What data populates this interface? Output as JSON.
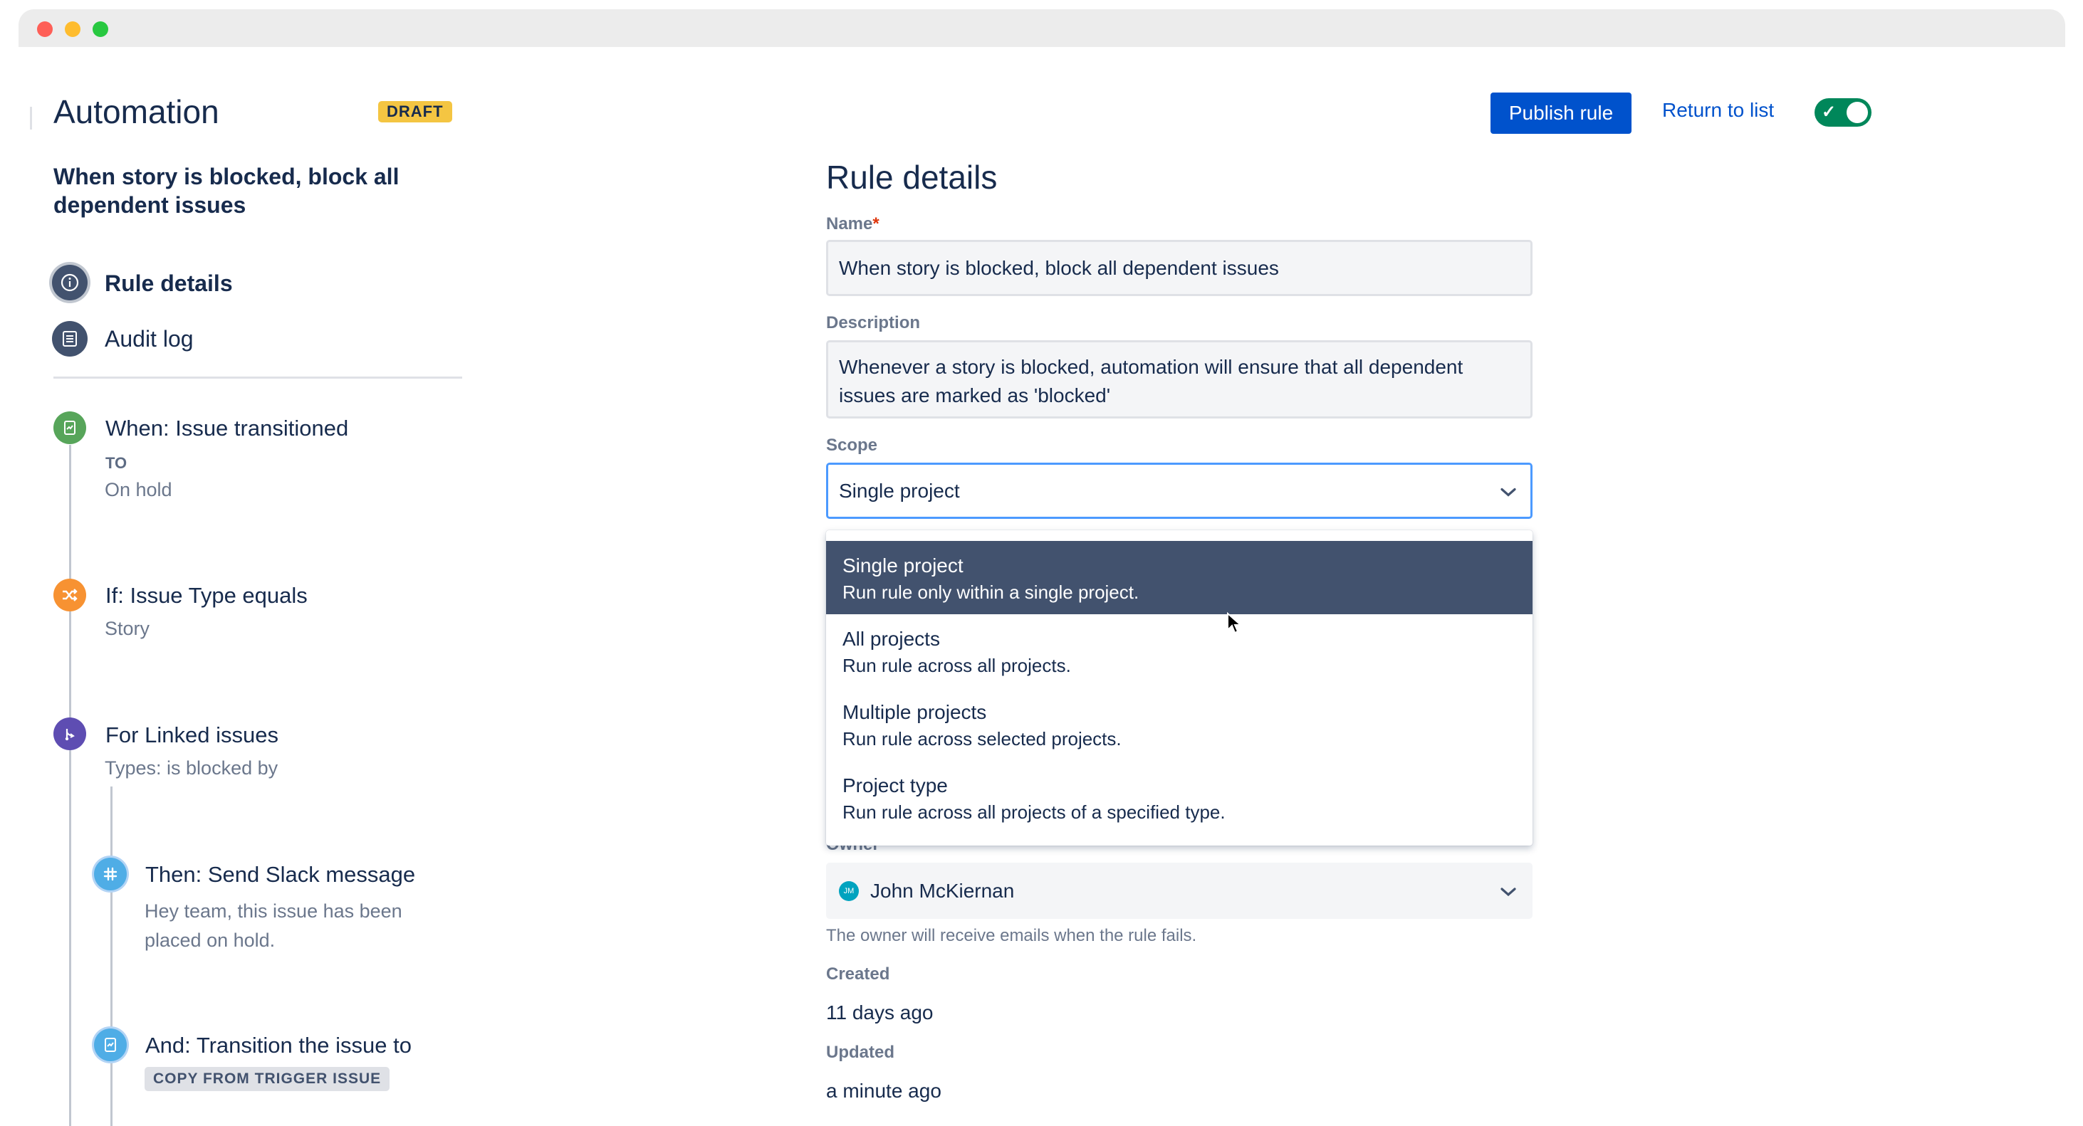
{
  "header": {
    "title": "Automation",
    "status_badge": "DRAFT",
    "publish_label": "Publish rule",
    "return_label": "Return to list",
    "enabled": true
  },
  "sidebar": {
    "rule_name": "When story is blocked, block all dependent issues",
    "nav": [
      {
        "label": "Rule details",
        "icon": "info-icon",
        "active": true
      },
      {
        "label": "Audit log",
        "icon": "list-icon",
        "active": false
      }
    ],
    "components": [
      {
        "title": "When: Issue transitioned",
        "to_label": "TO",
        "value": "On hold",
        "icon": "trigger-icon",
        "color": "#57a55a"
      },
      {
        "title": "If: Issue Type equals",
        "value": "Story",
        "icon": "shuffle-icon",
        "color": "#f79232"
      },
      {
        "title": "For Linked issues",
        "value": "Types: is blocked by",
        "icon": "branch-icon",
        "color": "#5e4db2"
      },
      {
        "title": "Then: Send Slack message",
        "value": "Hey team, this issue has been placed on hold.",
        "icon": "slack-icon",
        "color": "#4fade6"
      },
      {
        "title": "And: Transition the issue to",
        "badge": "COPY FROM TRIGGER ISSUE",
        "icon": "action-icon",
        "color": "#4fade6"
      }
    ]
  },
  "form": {
    "heading": "Rule details",
    "name_label": "Name",
    "name_required": "*",
    "name_value": "When story is blocked, block all dependent issues",
    "description_label": "Description",
    "description_value": "Whenever a story is blocked, automation will ensure that all dependent issues are marked as 'blocked'",
    "scope_label": "Scope",
    "scope_value": "Single project",
    "scope_options": [
      {
        "title": "Single project",
        "desc": "Run rule only within a single project.",
        "selected": true
      },
      {
        "title": "All projects",
        "desc": "Run rule across all projects."
      },
      {
        "title": "Multiple projects",
        "desc": "Run rule across selected projects."
      },
      {
        "title": "Project type",
        "desc": "Run rule across all projects of a specified type."
      }
    ],
    "owner_label": "Owner",
    "owner_initials": "JM",
    "owner_value": "John McKiernan",
    "owner_help": "The owner will receive emails when the rule fails.",
    "created_label": "Created",
    "created_value": "11 days ago",
    "updated_label": "Updated",
    "updated_value": "a minute ago"
  },
  "colors": {
    "primary": "#0052cc",
    "success": "#00875a",
    "draft": "#f4c542",
    "selected_option": "#42526e"
  }
}
